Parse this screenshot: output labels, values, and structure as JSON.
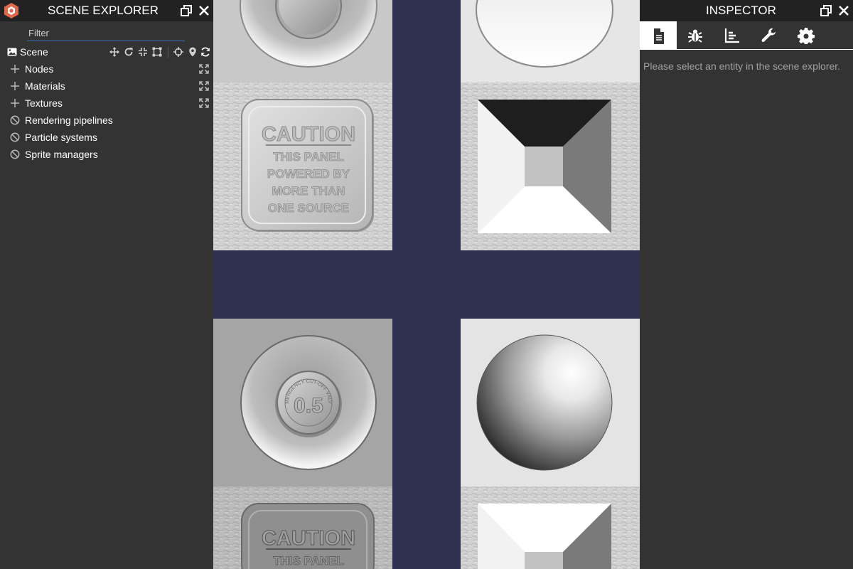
{
  "scene_explorer": {
    "title": "SCENE EXPLORER",
    "filter_placeholder": "Filter",
    "scene_label": "Scene",
    "items": [
      {
        "label": "Nodes",
        "icon": "plus-icon",
        "expandable": true
      },
      {
        "label": "Materials",
        "icon": "plus-icon",
        "expandable": true
      },
      {
        "label": "Textures",
        "icon": "plus-icon",
        "expandable": true
      },
      {
        "label": "Rendering pipelines",
        "icon": "ban-icon",
        "expandable": false
      },
      {
        "label": "Particle systems",
        "icon": "ban-icon",
        "expandable": false
      },
      {
        "label": "Sprite managers",
        "icon": "ban-icon",
        "expandable": false
      }
    ],
    "scene_tools": [
      "translate-gizmo-icon",
      "rotate-gizmo-icon",
      "scale-gizmo-icon",
      "bounding-box-gizmo-icon",
      "crosshair-icon",
      "map-marker-icon",
      "refresh-icon"
    ]
  },
  "viewport": {
    "caption_word": "CAUTION",
    "caption_lines": [
      "THIS PANEL",
      "POWERED BY",
      "MORE THAN",
      "ONE SOURCE"
    ],
    "valve_value": "0.5",
    "valve_ring_text": "EMERGENCY CUT-OFF VALVE",
    "background_color": "#303050"
  },
  "inspector": {
    "title": "INSPECTOR",
    "message": "Please select an entity in the scene explorer.",
    "tabs": [
      "properties-document-icon",
      "debug-bug-icon",
      "statistics-chart-icon",
      "tools-wrench-icon",
      "settings-gear-icon"
    ],
    "active_tab": 0
  },
  "colors": {
    "panel_bg": "#333333",
    "header_bg": "#222222",
    "accent_blue": "#3a72c2",
    "viewport_bg": "#303050"
  }
}
